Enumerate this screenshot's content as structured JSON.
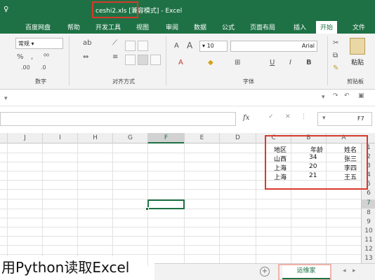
{
  "window": {
    "title": "ceshi2.xls [兼容模式] - Excel",
    "filename": "ceshi2.xls",
    "mode": "[兼容模式]",
    "app": "- Excel"
  },
  "ribbon_tabs": [
    "百度网盘",
    "帮助",
    "开发工具",
    "视图",
    "审阅",
    "数据",
    "公式",
    "页面布局",
    "插入",
    "开始",
    "文件"
  ],
  "active_tab": "开始",
  "ribbon": {
    "groups": [
      "剪贴板",
      "字体",
      "对齐方式",
      "数字"
    ],
    "font_name": "Arial",
    "font_size": "10",
    "number_format": "常规",
    "paste_label": "粘贴"
  },
  "formula_bar": {
    "cell_ref": "F7",
    "fx": "fx"
  },
  "columns": [
    "A",
    "B",
    "C",
    "D",
    "E",
    "F",
    "G",
    "H",
    "I",
    "J"
  ],
  "selected_column": "F",
  "rows": [
    "1",
    "2",
    "3",
    "4",
    "5",
    "6",
    "7",
    "8",
    "9",
    "10",
    "11",
    "12",
    "13"
  ],
  "selected_row": "7",
  "table": {
    "headers": [
      "姓名",
      "年龄",
      "地区"
    ],
    "rows": [
      [
        "张三",
        "34",
        "山西"
      ],
      [
        "李四",
        "20",
        "上海"
      ],
      [
        "王五",
        "21",
        "上海"
      ]
    ]
  },
  "sheet": {
    "name": "运维家",
    "add": "+"
  },
  "caption": "用Python读取Excel",
  "colors": {
    "excel_green": "#1e7145",
    "highlight_red": "#d83a2a"
  }
}
